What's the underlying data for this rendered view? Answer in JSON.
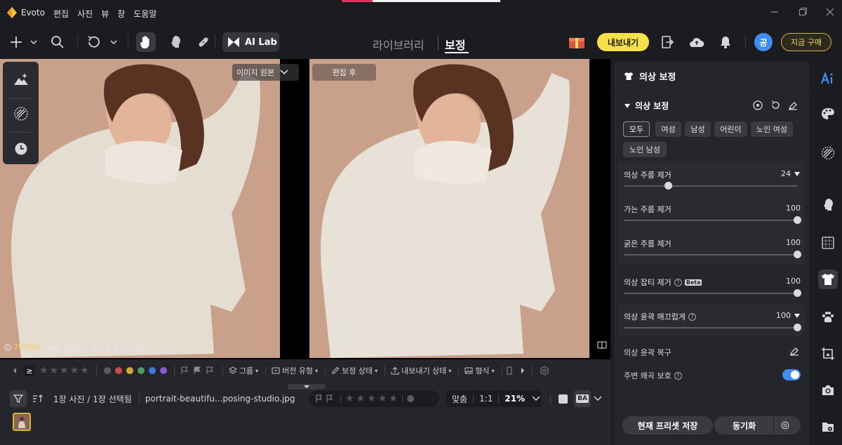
{
  "app": {
    "name": "Evoto"
  },
  "menu": [
    "편집",
    "사진",
    "뷰",
    "창",
    "도움말"
  ],
  "toolbar": {
    "ailab_label": "AI Lab",
    "tab_library": "라이브러리",
    "tab_edit": "보정",
    "export_label": "내보내기",
    "avatar_initial": "공",
    "buy_label": "지금 구매"
  },
  "canvas": {
    "orig_label": "이미지 원본",
    "after_label": "편집 후",
    "resolution_value": "2048px",
    "resolution_note": "- 빠른 미리보기 모드로 표시됩니다"
  },
  "filterbar": {
    "ge_symbol": "≥",
    "group": "그룹",
    "version": "버전 유형",
    "status": "보정 상태",
    "export_status": "내보내기 상태",
    "format": "형식"
  },
  "infobar": {
    "count": "1장 사진 / 1장 선택됨",
    "filename": "portrait-beautifu...posing-studio.jpg",
    "fit": "맞춤",
    "ratio": "1:1",
    "zoom": "21%",
    "ba": "BA"
  },
  "panel": {
    "title": "의상 보정",
    "section": "의상 보정",
    "chips": [
      "모두",
      "여성",
      "남성",
      "어린이",
      "노인 여성",
      "노인 남성"
    ],
    "sliders": [
      {
        "label": "의상 주름 제거",
        "value": "24",
        "level": 0.24
      },
      {
        "label": "가는 주름 제거",
        "value": "100",
        "level": 1.0
      },
      {
        "label": "굵은 주름 제거",
        "value": "100",
        "level": 1.0
      },
      {
        "label": "의상 잡티 제거",
        "value": "100",
        "level": 1.0,
        "badge": "Beta"
      },
      {
        "label": "의상 윤곽 매끄럽게",
        "value": "100",
        "level": 1.0
      }
    ],
    "restore_label": "의상 윤곽 복구",
    "protect_label": "주변 왜곡 보호",
    "protect_on": true,
    "save_preset": "현재 프리셋 저장",
    "sync": "동기화"
  },
  "colors": {
    "accent_yellow": "#f5e04a",
    "accent_blue": "#3d8ef2",
    "label_dots": [
      "#5a5b60",
      "#c94a4a",
      "#d4a63a",
      "#4aa05a",
      "#3d7ad8",
      "#8a5ad0"
    ]
  }
}
